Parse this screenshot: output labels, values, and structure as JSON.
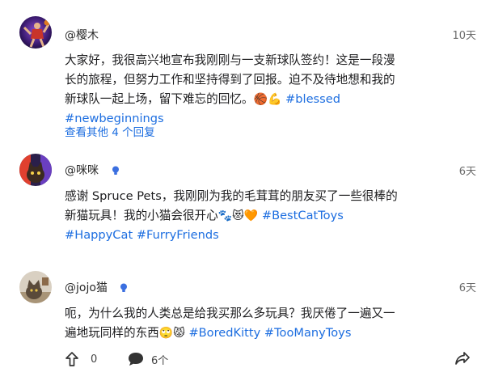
{
  "posts": [
    {
      "username": "@樱木",
      "time": "10天",
      "text": "大家好，我很高兴地宣布我刚刚与一支新球队签约！这是一段漫长的旅程，但努力工作和坚持得到了回报。迫不及待地想和我的新球队一起上场，留下难忘的回忆。",
      "emoji": "🏀💪",
      "hashtags": [
        "#blessed",
        "#newbeginnings"
      ],
      "view_replies": "查看其他 4 个回复"
    },
    {
      "username": "@咪咪",
      "time": "6天",
      "verified": true,
      "text": "感谢 Spruce Pets，我刚刚为我的毛茸茸的朋友买了一些很棒的新猫玩具！我的小猫会很开心",
      "emoji": "🐾😻🧡",
      "hashtags": [
        "#BestCatToys",
        "#HappyCat",
        "#FurryFriends"
      ]
    },
    {
      "username": "@jojo猫",
      "time": "6天",
      "verified": true,
      "text": "呃，为什么我的人类总是给我买那么多玩具？我厌倦了一遍又一遍地玩同样的东西",
      "emoji": "🙄😾",
      "hashtags": [
        "#BoredKitty",
        "#TooManyToys"
      ]
    }
  ],
  "action_bar": {
    "vote_count": "0",
    "comment_count": "6个"
  },
  "icons": {
    "verified": "bulb-badge-icon",
    "upvote": "arrow-up-icon",
    "comment": "speech-bubble-icon",
    "share": "share-arrow-icon"
  },
  "colors": {
    "link": "#1d6ee0",
    "verified": "#3b6fe0"
  }
}
